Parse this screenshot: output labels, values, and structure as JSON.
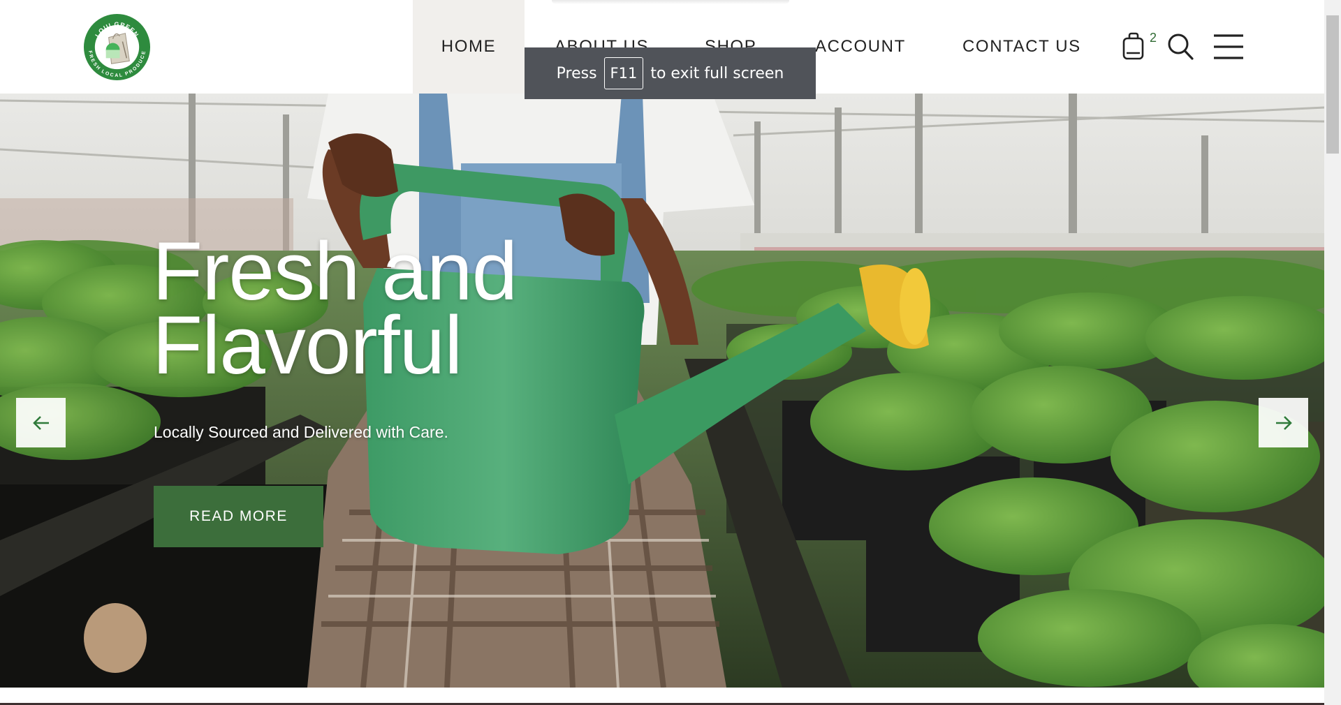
{
  "logo": {
    "top_text": "LOUI GREEN",
    "bottom_text": "FRESH LOCAL PRODUCE",
    "colors": {
      "ring": "#2e8b3e",
      "inner": "#ffffff"
    }
  },
  "nav": {
    "items": [
      {
        "label": "HOME",
        "active": true
      },
      {
        "label": "ABOUT US",
        "active": false
      },
      {
        "label": "SHOP",
        "active": false
      },
      {
        "label": "ACCOUNT",
        "active": false
      },
      {
        "label": "CONTACT US",
        "active": false
      }
    ]
  },
  "header_icons": {
    "cart_icon": "shopping-bag-icon",
    "cart_count": "2",
    "search_icon": "search-icon",
    "menu_icon": "hamburger-menu-icon"
  },
  "fullscreen_notice": {
    "before": "Press",
    "key": "F11",
    "after": "to exit full screen"
  },
  "hero": {
    "title_line1": "Fresh and",
    "title_line2": "Flavorful",
    "subtitle": "Locally Sourced and Delivered with Care.",
    "button_label": "READ MORE",
    "prev_icon": "arrow-left-icon",
    "next_icon": "arrow-right-icon"
  },
  "colors": {
    "accent_green": "#3c6e3b",
    "nav_active_bg": "#f1efec",
    "toast_bg": "#505359"
  }
}
